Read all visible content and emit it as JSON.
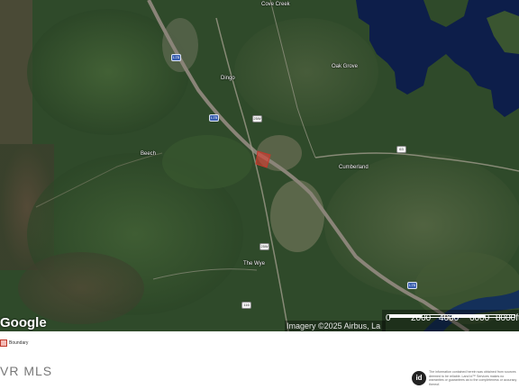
{
  "map": {
    "place_labels": {
      "cove_creek": "Cove Creek",
      "dingo": "Dingo",
      "oak_grove": "Oak Grove",
      "cumberland": "Cumberland",
      "the_wye": "The Wye",
      "beech": "Beech"
    },
    "route_shields": {
      "i75_north": "I-75",
      "i75_mid": "I-75",
      "i75_south": "I-75",
      "us_25w_a": "25W",
      "us_25w_b": "25W",
      "sr_63": "63",
      "sr_116": "116"
    },
    "colors": {
      "forest": "#2f4a2a",
      "water": "#0d1e4a",
      "highway": "#8a8478",
      "boundary": "#c0392b"
    }
  },
  "google_logo": "Google",
  "attribution": "Imagery ©2025 Airbus, La",
  "scale": {
    "labels": [
      "0",
      "2000",
      "4000",
      "6000",
      "8000ft"
    ]
  },
  "legend": {
    "label": "Boundary"
  },
  "footer": {
    "mls_logo": "VR MLS",
    "idx_badge": "id",
    "idx_disclaimer": "The information contained herein was obtained from sources deemed to be reliable. Land id™ Services makes no warranties or guarantees as to the completeness or accuracy thereof."
  }
}
